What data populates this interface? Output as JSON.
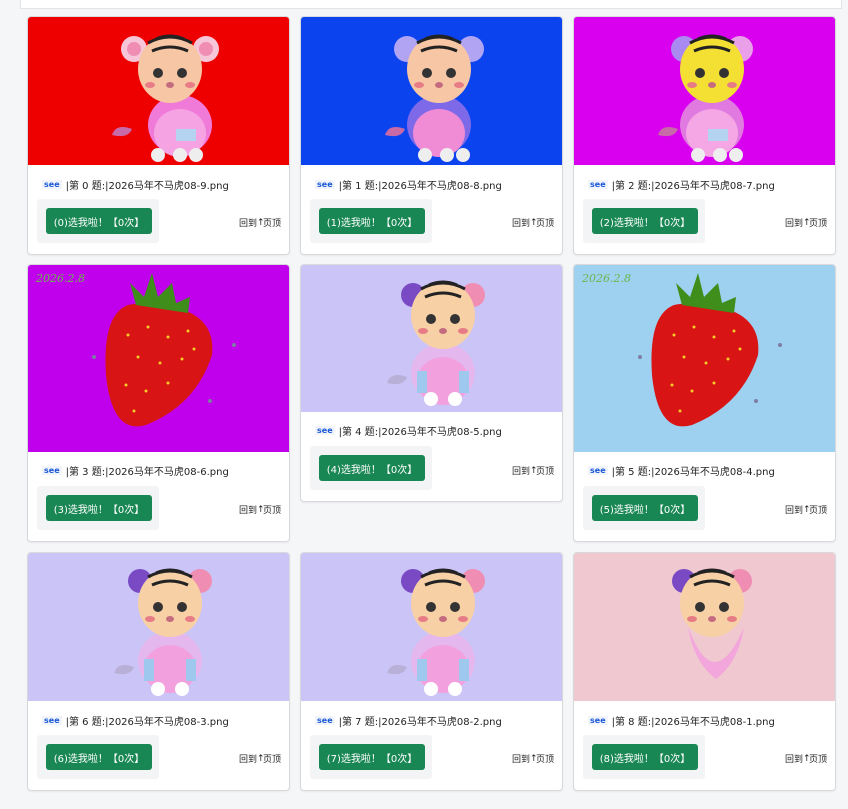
{
  "cards": [
    {
      "see": "see",
      "title": "|第 0 题:|2026马年不马虎08-9.png",
      "vote": "(0)选我啦！【0次】",
      "totop_a": "回到",
      "totop_b": "页顶"
    },
    {
      "see": "see",
      "title": "|第 1 题:|2026马年不马虎08-8.png",
      "vote": "(1)选我啦！【0次】",
      "totop_a": "回到",
      "totop_b": "页顶"
    },
    {
      "see": "see",
      "title": "|第 2 题:|2026马年不马虎08-7.png",
      "vote": "(2)选我啦！【0次】",
      "totop_a": "回到",
      "totop_b": "页顶"
    },
    {
      "see": "see",
      "title": "|第 3 题:|2026马年不马虎08-6.png",
      "vote": "(3)选我啦！【0次】",
      "totop_a": "回到",
      "totop_b": "页顶",
      "img_text": "2026.2.8"
    },
    {
      "see": "see",
      "title": "|第 4 题:|2026马年不马虎08-5.png",
      "vote": "(4)选我啦！【0次】",
      "totop_a": "回到",
      "totop_b": "页顶"
    },
    {
      "see": "see",
      "title": "|第 5 题:|2026马年不马虎08-4.png",
      "vote": "(5)选我啦！【0次】",
      "totop_a": "回到",
      "totop_b": "页顶",
      "img_text": "2026.2.8"
    },
    {
      "see": "see",
      "title": "|第 6 题:|2026马年不马虎08-3.png",
      "vote": "(6)选我啦！【0次】",
      "totop_a": "回到",
      "totop_b": "页顶"
    },
    {
      "see": "see",
      "title": "|第 7 题:|2026马年不马虎08-2.png",
      "vote": "(7)选我啦！【0次】",
      "totop_a": "回到",
      "totop_b": "页顶"
    },
    {
      "see": "see",
      "title": "|第 8 题:|2026马年不马虎08-1.png",
      "vote": "(8)选我啦！【0次】",
      "totop_a": "回到",
      "totop_b": "页顶"
    }
  ],
  "colors": {
    "card0_bg": "#ee0000",
    "card1_bg": "#0b44ef",
    "card2_bg": "#d800ee",
    "card3_bg": "#c000ec",
    "card4_bg": "#cbc4f6",
    "card5_bg": "#9ed0ef",
    "card6_bg": "#cbc4f6",
    "card7_bg": "#cbc4f6",
    "card8_bg": "#f0c9d0",
    "vote_button": "#198754"
  }
}
